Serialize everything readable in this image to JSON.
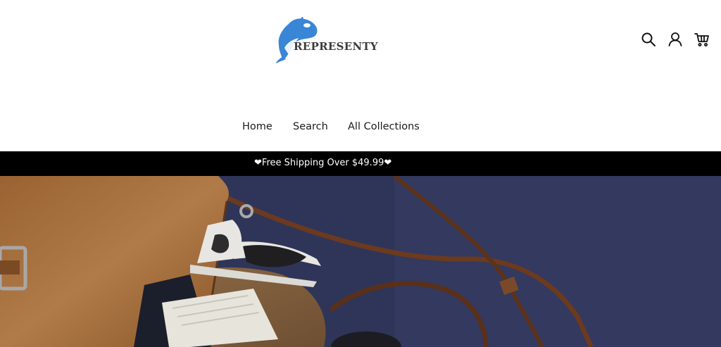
{
  "brand": {
    "name": "REPRESENTY",
    "logo_color": "#3a86d6"
  },
  "header_icons": [
    "search-icon",
    "account-icon",
    "cart-icon"
  ],
  "nav": {
    "items": [
      {
        "label": "Home"
      },
      {
        "label": "Search"
      },
      {
        "label": "All Collections"
      }
    ]
  },
  "announcement": {
    "text": "Free Shipping Over $49.99",
    "heart": "❤",
    "background": "#000000",
    "color": "#ffffff"
  },
  "hero": {
    "image": "leather-bag-and-sunglasses-photo"
  }
}
